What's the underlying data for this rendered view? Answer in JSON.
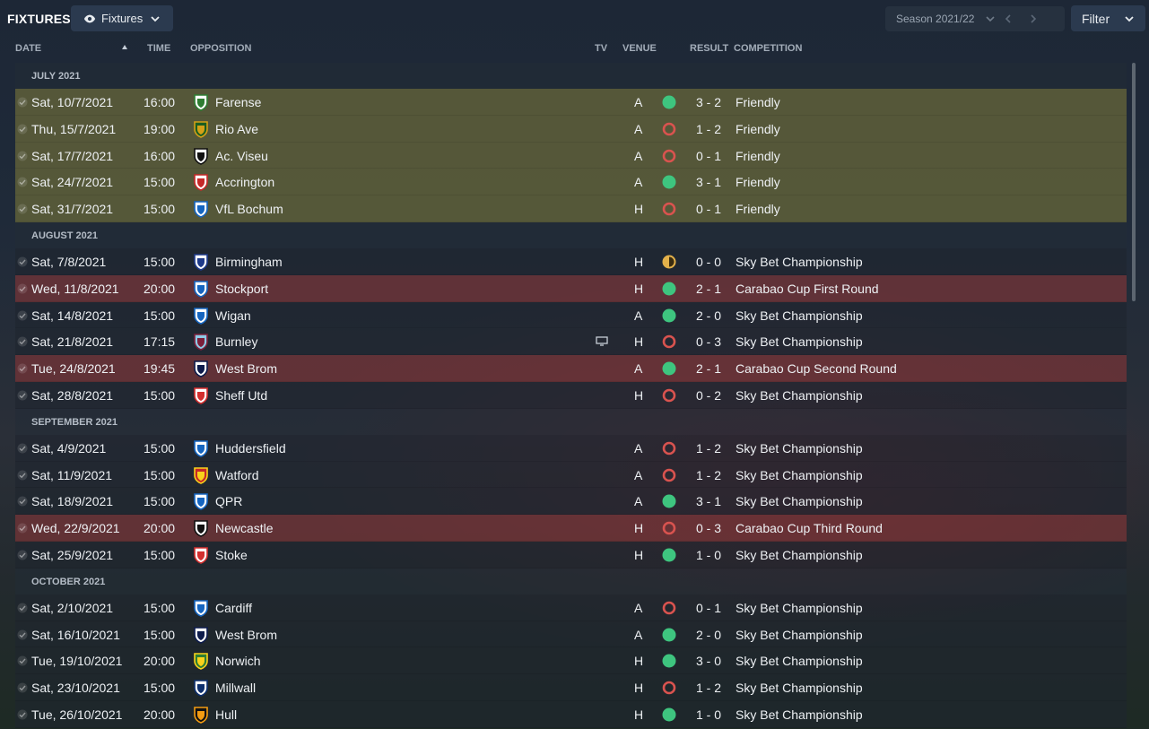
{
  "header": {
    "title": "FIXTURES",
    "view_label": "Fixtures",
    "season_label": "Season 2021/22",
    "filter_label": "Filter"
  },
  "columns": {
    "date": "DATE",
    "time": "TIME",
    "opposition": "OPPOSITION",
    "tv": "TV",
    "venue": "VENUE",
    "result": "RESULT",
    "competition": "COMPETITION"
  },
  "colors": {
    "win": "#3ec57f",
    "loss": "#d9534f",
    "draw": "#e3b14a",
    "friendly_row": "#78743a",
    "cup_row": "#783438"
  },
  "months": [
    {
      "label": "JULY 2021",
      "fixtures": [
        {
          "date": "Sat, 10/7/2021",
          "time": "16:00",
          "opp": "Farense",
          "venue": "A",
          "result": "win",
          "score": "3 - 2",
          "comp": "Friendly",
          "kind": "friendly",
          "tv": false,
          "crest": [
            "#2e7d32",
            "#ffffff"
          ]
        },
        {
          "date": "Thu, 15/7/2021",
          "time": "19:00",
          "opp": "Rio Ave",
          "venue": "A",
          "result": "loss",
          "score": "1 - 2",
          "comp": "Friendly",
          "kind": "friendly",
          "tv": false,
          "crest": [
            "#d4a017",
            "#1b5e20"
          ]
        },
        {
          "date": "Sat, 17/7/2021",
          "time": "16:00",
          "opp": "Ac. Viseu",
          "venue": "A",
          "result": "loss",
          "score": "0 - 1",
          "comp": "Friendly",
          "kind": "friendly",
          "tv": false,
          "crest": [
            "#111111",
            "#ffffff"
          ]
        },
        {
          "date": "Sat, 24/7/2021",
          "time": "15:00",
          "opp": "Accrington",
          "venue": "A",
          "result": "win",
          "score": "3 - 1",
          "comp": "Friendly",
          "kind": "friendly",
          "tv": false,
          "crest": [
            "#c62828",
            "#ffffff"
          ]
        },
        {
          "date": "Sat, 31/7/2021",
          "time": "15:00",
          "opp": "VfL Bochum",
          "venue": "H",
          "result": "loss",
          "score": "0 - 1",
          "comp": "Friendly",
          "kind": "friendly",
          "tv": false,
          "crest": [
            "#1565c0",
            "#ffffff"
          ]
        }
      ]
    },
    {
      "label": "AUGUST 2021",
      "fixtures": [
        {
          "date": "Sat, 7/8/2021",
          "time": "15:00",
          "opp": "Birmingham",
          "venue": "H",
          "result": "draw",
          "score": "0 - 0",
          "comp": "Sky Bet Championship",
          "kind": "league",
          "tv": false,
          "crest": [
            "#1e3a8a",
            "#ffffff"
          ]
        },
        {
          "date": "Wed, 11/8/2021",
          "time": "20:00",
          "opp": "Stockport",
          "venue": "H",
          "result": "win",
          "score": "2 - 1",
          "comp": "Carabao Cup First Round",
          "kind": "cup",
          "tv": false,
          "crest": [
            "#1565c0",
            "#ffffff"
          ]
        },
        {
          "date": "Sat, 14/8/2021",
          "time": "15:00",
          "opp": "Wigan",
          "venue": "A",
          "result": "win",
          "score": "2 - 0",
          "comp": "Sky Bet Championship",
          "kind": "league",
          "tv": false,
          "crest": [
            "#1565c0",
            "#ffffff"
          ]
        },
        {
          "date": "Sat, 21/8/2021",
          "time": "17:15",
          "opp": "Burnley",
          "venue": "H",
          "result": "loss",
          "score": "0 - 3",
          "comp": "Sky Bet Championship",
          "kind": "league",
          "tv": true,
          "crest": [
            "#7b1f3a",
            "#8ecae6"
          ]
        },
        {
          "date": "Tue, 24/8/2021",
          "time": "19:45",
          "opp": "West Brom",
          "venue": "A",
          "result": "win",
          "score": "2 - 1",
          "comp": "Carabao Cup Second Round",
          "kind": "cup",
          "tv": false,
          "crest": [
            "#0d1b4c",
            "#ffffff"
          ]
        },
        {
          "date": "Sat, 28/8/2021",
          "time": "15:00",
          "opp": "Sheff Utd",
          "venue": "H",
          "result": "loss",
          "score": "0 - 2",
          "comp": "Sky Bet Championship",
          "kind": "league",
          "tv": false,
          "crest": [
            "#d32f2f",
            "#ffffff"
          ]
        }
      ]
    },
    {
      "label": "SEPTEMBER 2021",
      "fixtures": [
        {
          "date": "Sat, 4/9/2021",
          "time": "15:00",
          "opp": "Huddersfield",
          "venue": "A",
          "result": "loss",
          "score": "1 - 2",
          "comp": "Sky Bet Championship",
          "kind": "league",
          "tv": false,
          "crest": [
            "#1565c0",
            "#ffffff"
          ]
        },
        {
          "date": "Sat, 11/9/2021",
          "time": "15:00",
          "opp": "Watford",
          "venue": "A",
          "result": "loss",
          "score": "1 - 2",
          "comp": "Sky Bet Championship",
          "kind": "league",
          "tv": false,
          "crest": [
            "#f9d21b",
            "#c62828"
          ]
        },
        {
          "date": "Sat, 18/9/2021",
          "time": "15:00",
          "opp": "QPR",
          "venue": "A",
          "result": "win",
          "score": "3 - 1",
          "comp": "Sky Bet Championship",
          "kind": "league",
          "tv": false,
          "crest": [
            "#1565c0",
            "#ffffff"
          ]
        },
        {
          "date": "Wed, 22/9/2021",
          "time": "20:00",
          "opp": "Newcastle",
          "venue": "H",
          "result": "loss",
          "score": "0 - 3",
          "comp": "Carabao Cup Third Round",
          "kind": "cup",
          "tv": false,
          "crest": [
            "#111111",
            "#ffffff"
          ]
        },
        {
          "date": "Sat, 25/9/2021",
          "time": "15:00",
          "opp": "Stoke",
          "venue": "H",
          "result": "win",
          "score": "1 - 0",
          "comp": "Sky Bet Championship",
          "kind": "league",
          "tv": false,
          "crest": [
            "#d32f2f",
            "#ffffff"
          ]
        }
      ]
    },
    {
      "label": "OCTOBER 2021",
      "fixtures": [
        {
          "date": "Sat, 2/10/2021",
          "time": "15:00",
          "opp": "Cardiff",
          "venue": "A",
          "result": "loss",
          "score": "0 - 1",
          "comp": "Sky Bet Championship",
          "kind": "league",
          "tv": false,
          "crest": [
            "#1565c0",
            "#ffffff"
          ]
        },
        {
          "date": "Sat, 16/10/2021",
          "time": "15:00",
          "opp": "West Brom",
          "venue": "A",
          "result": "win",
          "score": "2 - 0",
          "comp": "Sky Bet Championship",
          "kind": "league",
          "tv": false,
          "crest": [
            "#0d1b4c",
            "#ffffff"
          ]
        },
        {
          "date": "Tue, 19/10/2021",
          "time": "20:00",
          "opp": "Norwich",
          "venue": "H",
          "result": "win",
          "score": "3 - 0",
          "comp": "Sky Bet Championship",
          "kind": "league",
          "tv": false,
          "crest": [
            "#f9d21b",
            "#2e7d32"
          ]
        },
        {
          "date": "Sat, 23/10/2021",
          "time": "15:00",
          "opp": "Millwall",
          "venue": "H",
          "result": "loss",
          "score": "1 - 2",
          "comp": "Sky Bet Championship",
          "kind": "league",
          "tv": false,
          "crest": [
            "#0d2f6e",
            "#ffffff"
          ]
        },
        {
          "date": "Tue, 26/10/2021",
          "time": "20:00",
          "opp": "Hull",
          "venue": "H",
          "result": "win",
          "score": "1 - 0",
          "comp": "Sky Bet Championship",
          "kind": "league",
          "tv": false,
          "crest": [
            "#f39c12",
            "#111111"
          ]
        }
      ]
    }
  ]
}
